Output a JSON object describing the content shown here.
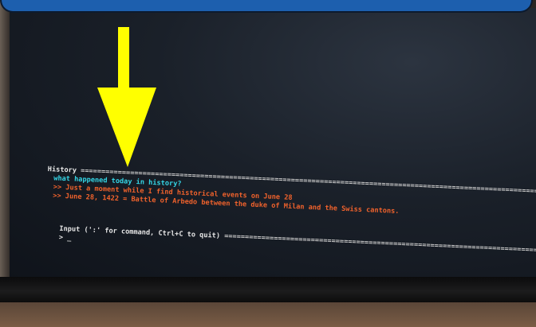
{
  "terminal": {
    "history_header": "History",
    "history_rule": "=============================================================================================================================",
    "lines": [
      {
        "text": "what happened today in history?",
        "color": "#35d6e6"
      },
      {
        "text": ">> Just a moment while I find historical events on June 28",
        "color": "#f0622c"
      },
      {
        "text": ">> June 28, 1422 = Battle of Arbedo between the duke of Milan and the Swiss cantons.",
        "color": "#f0622c"
      }
    ],
    "input_label": "Input (':' for command, Ctrl+C to quit)",
    "input_rule": "=============================================================================",
    "prompt": "> _"
  },
  "colors": {
    "banner": "#1d5fae",
    "arrow": "#ffff00",
    "terminal_bg": "#1a2029"
  },
  "icons": {
    "arrow": "down-arrow-icon"
  }
}
